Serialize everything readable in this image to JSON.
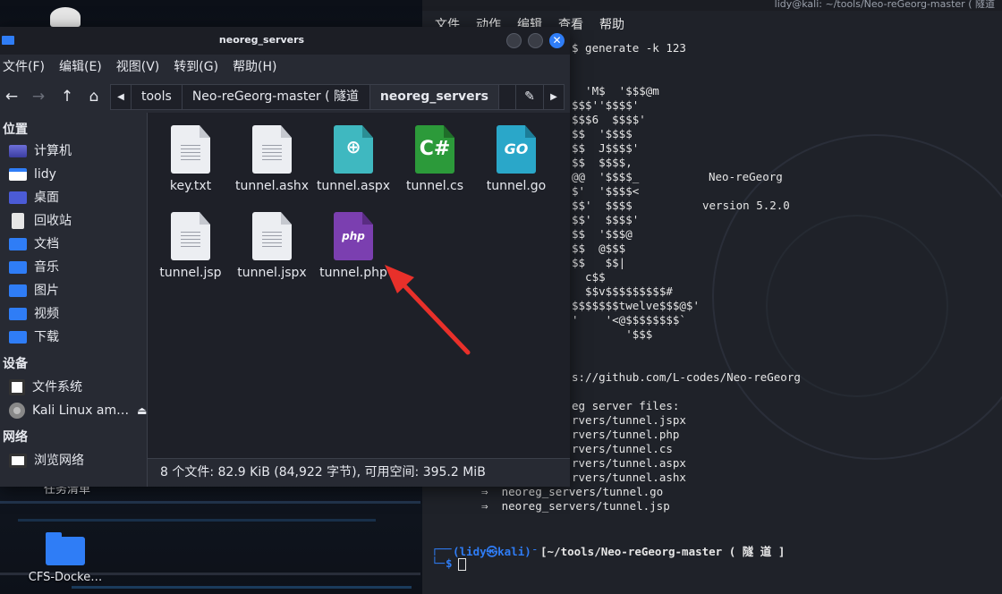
{
  "desktop": {
    "icons": [
      {
        "label": "CFS-Docke…"
      },
      {
        "label": "任务清单"
      }
    ]
  },
  "terminal": {
    "title": "lidy@kali: ~/tools/Neo-reGeorg-master ( 隧道",
    "menu": [
      "文件",
      "动作",
      "编辑",
      "查看",
      "帮助"
    ],
    "lines": [
      "$ generate -k 123",
      "  'M$  '$$$@m",
      "$$$''$$$$'",
      "$$$6  $$$$'",
      "$$  '$$$$",
      "$$  J$$$$'",
      "$$  $$$$,",
      "@@  '$$$$_",
      "$'  '$$$$<",
      "$$'  $$$$",
      "$$'  $$$$'",
      "$$  '$$$@",
      "$$  @$$$",
      "$$   $$|",
      "  c$$",
      "  $$v$$$$$$$$$#",
      "$$$$$$$twelve$$$@$'",
      "'    '<@$$$$$$$$`",
      "        '$$$",
      "s://github.com/L-codes/Neo-reGeorg",
      "eg server files:",
      "rvers/tunnel.jspx",
      "rvers/tunnel.php",
      "rvers/tunnel.cs",
      "rvers/tunnel.aspx",
      "rvers/tunnel.ashx",
      "⇒  neoreg_servers/tunnel.go",
      "⇒  neoreg_servers/tunnel.jsp"
    ],
    "banner_name": "Neo-reGeorg",
    "banner_version": "version 5.2.0",
    "prompt_user": "(lidy㉿kali)",
    "prompt_path": "[~/tools/Neo-reGeorg-master ( 隧 道 ]",
    "prompt_symbol": "$"
  },
  "file_manager": {
    "title": "neoreg_servers",
    "menu": [
      "文件(F)",
      "编辑(E)",
      "视图(V)",
      "转到(G)",
      "帮助(H)"
    ],
    "breadcrumbs": [
      "tools",
      "Neo-reGeorg-master ( 隧道",
      "neoreg_servers"
    ],
    "sidebar": {
      "places_header": "位置",
      "places": [
        "计算机",
        "lidy",
        "桌面",
        "回收站",
        "文档",
        "音乐",
        "图片",
        "视频",
        "下载"
      ],
      "devices_header": "设备",
      "devices": [
        "文件系统",
        "Kali Linux am…"
      ],
      "network_header": "网络",
      "network": [
        "浏览网络"
      ]
    },
    "files": [
      {
        "name": "key.txt",
        "icon": "text-file-icon"
      },
      {
        "name": "tunnel.ashx",
        "icon": "text-file-icon"
      },
      {
        "name": "tunnel.aspx",
        "icon": "web-file-icon",
        "color": "#3fb8c0"
      },
      {
        "name": "tunnel.cs",
        "icon": "csharp-file-icon",
        "color": "#2c9a3a",
        "glyph": "C#"
      },
      {
        "name": "tunnel.go",
        "icon": "go-file-icon",
        "color": "#2aa7c9",
        "glyph": "GO"
      },
      {
        "name": "tunnel.jsp",
        "icon": "text-file-icon"
      },
      {
        "name": "tunnel.jspx",
        "icon": "text-file-icon"
      },
      {
        "name": "tunnel.php",
        "icon": "php-file-icon",
        "color": "#7b3fb0",
        "glyph": "php"
      }
    ],
    "status": "8 个文件: 82.9 KiB (84,922 字节), 可用空间: 395.2 MiB"
  },
  "colors": {
    "accent": "#2f7df6",
    "arrow": "#e8302a",
    "prompt": "#2f7df6"
  }
}
